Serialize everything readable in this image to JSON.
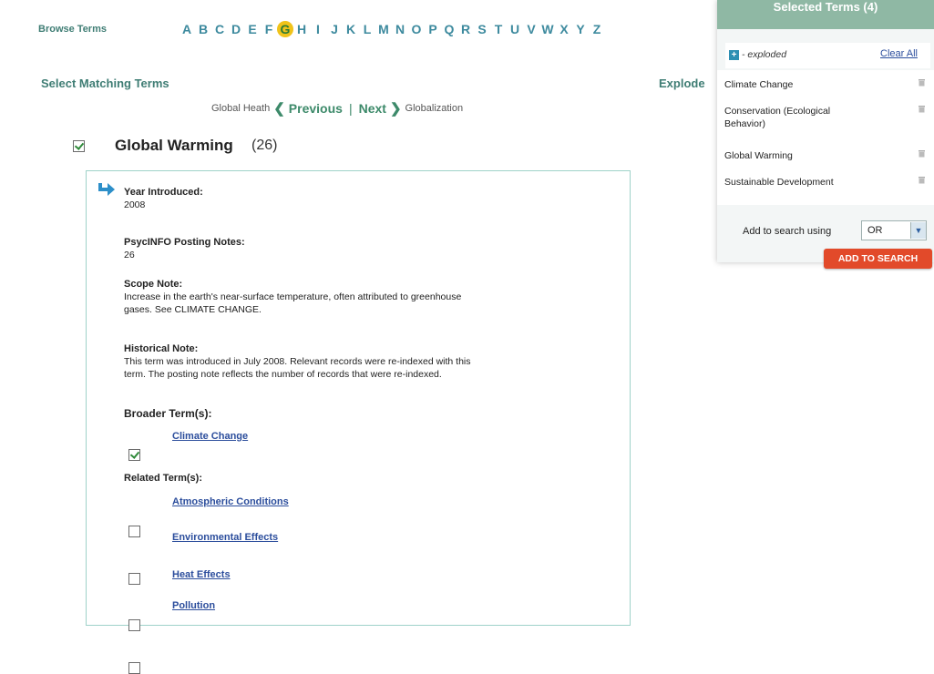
{
  "browse": {
    "label": "Browse Terms",
    "letters": [
      "A",
      "B",
      "C",
      "D",
      "E",
      "F",
      "G",
      "H",
      "I",
      "J",
      "K",
      "L",
      "M",
      "N",
      "O",
      "P",
      "Q",
      "R",
      "S",
      "T",
      "U",
      "V",
      "W",
      "X",
      "Y",
      "Z"
    ],
    "active_letter": "G"
  },
  "select_matching_label": "Select Matching Terms",
  "explode_label": "Explode",
  "pager": {
    "prev_term": "Global Heath",
    "prev_label": "Previous",
    "separator": "|",
    "next_label": "Next",
    "next_term": "Globalization"
  },
  "term": {
    "title": "Global Warming",
    "count": "(26)",
    "checked": true
  },
  "detail": {
    "year_heading": "Year Introduced:",
    "year_value": "2008",
    "posting_heading": "PsycINFO Posting Notes:",
    "posting_value": "26",
    "scope_heading": "Scope Note:",
    "scope_line1": "Increase in the earth's near-surface temperature, often attributed to greenhouse",
    "scope_line2": "gases. See CLIMATE CHANGE.",
    "hist_heading": "Historical Note:",
    "hist_line1": "This term was introduced in July 2008. Relevant records were re-indexed with this",
    "hist_line2": "term. The posting note reflects the number of records that were re-indexed.",
    "broader_heading": "Broader Term(s):",
    "broader_terms": [
      {
        "label": "Climate Change",
        "checked": true
      }
    ],
    "related_heading": "Related Term(s):",
    "related_terms": [
      {
        "label": "Atmospheric Conditions",
        "checked": false
      },
      {
        "label": "Environmental Effects",
        "checked": false
      },
      {
        "label": "Heat Effects",
        "checked": false
      },
      {
        "label": "Pollution",
        "checked": false
      }
    ]
  },
  "panel": {
    "header": "Selected Terms (4)",
    "legend_text": "- exploded",
    "clear_all": "Clear All",
    "selected_terms": [
      {
        "line1": "Climate Change",
        "line2": ""
      },
      {
        "line1": "Conservation (Ecological",
        "line2": "Behavior)"
      },
      {
        "line1": "Global Warming",
        "line2": ""
      },
      {
        "line1": "Sustainable Development",
        "line2": ""
      }
    ],
    "add_label": "Add to search using",
    "operator": "OR",
    "add_button": "ADD TO SEARCH"
  },
  "colors": {
    "accent_green": "#3f7d74",
    "letter_blue": "#3d8a9e",
    "active_letter_bg": "#f0c31a",
    "button_red": "#e24a2a",
    "header_green": "#8fb8a4"
  }
}
